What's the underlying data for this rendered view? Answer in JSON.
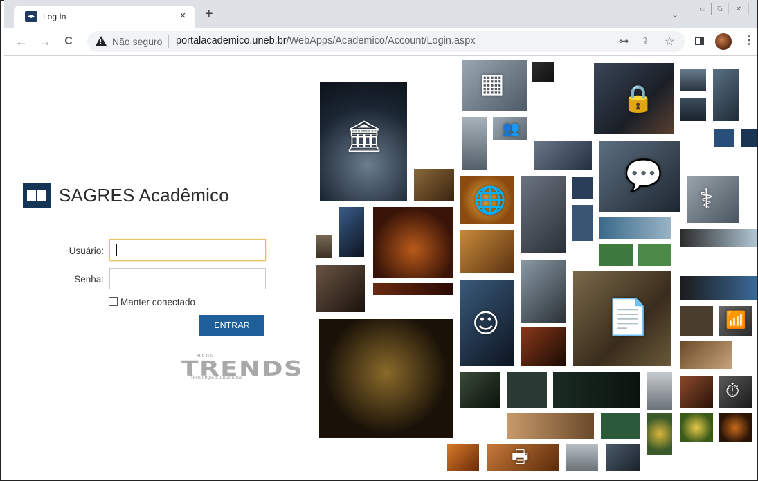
{
  "browser": {
    "tab_title": "Log In",
    "tab_close": "×",
    "new_tab": "+",
    "tab_menu": "⌄",
    "security_label": "Não seguro",
    "url_host": "portalacademico.uneb.br",
    "url_path": "/WebApps/Academico/Account/Login.aspx",
    "back": "←",
    "forward": "→",
    "reload": "C",
    "key_icon": "⊶",
    "share_icon": "⇪",
    "star_icon": "☆",
    "menu": "⋮"
  },
  "app": {
    "title": "SAGRES Acadêmico"
  },
  "login": {
    "username_label": "Usuário:",
    "password_label": "Senha:",
    "remember_label": "Manter conectado",
    "submit_label": "ENTRAR"
  },
  "branding": {
    "top": "ecno",
    "name": "TRENDS",
    "tagline": "Tecnologia Educacional"
  }
}
